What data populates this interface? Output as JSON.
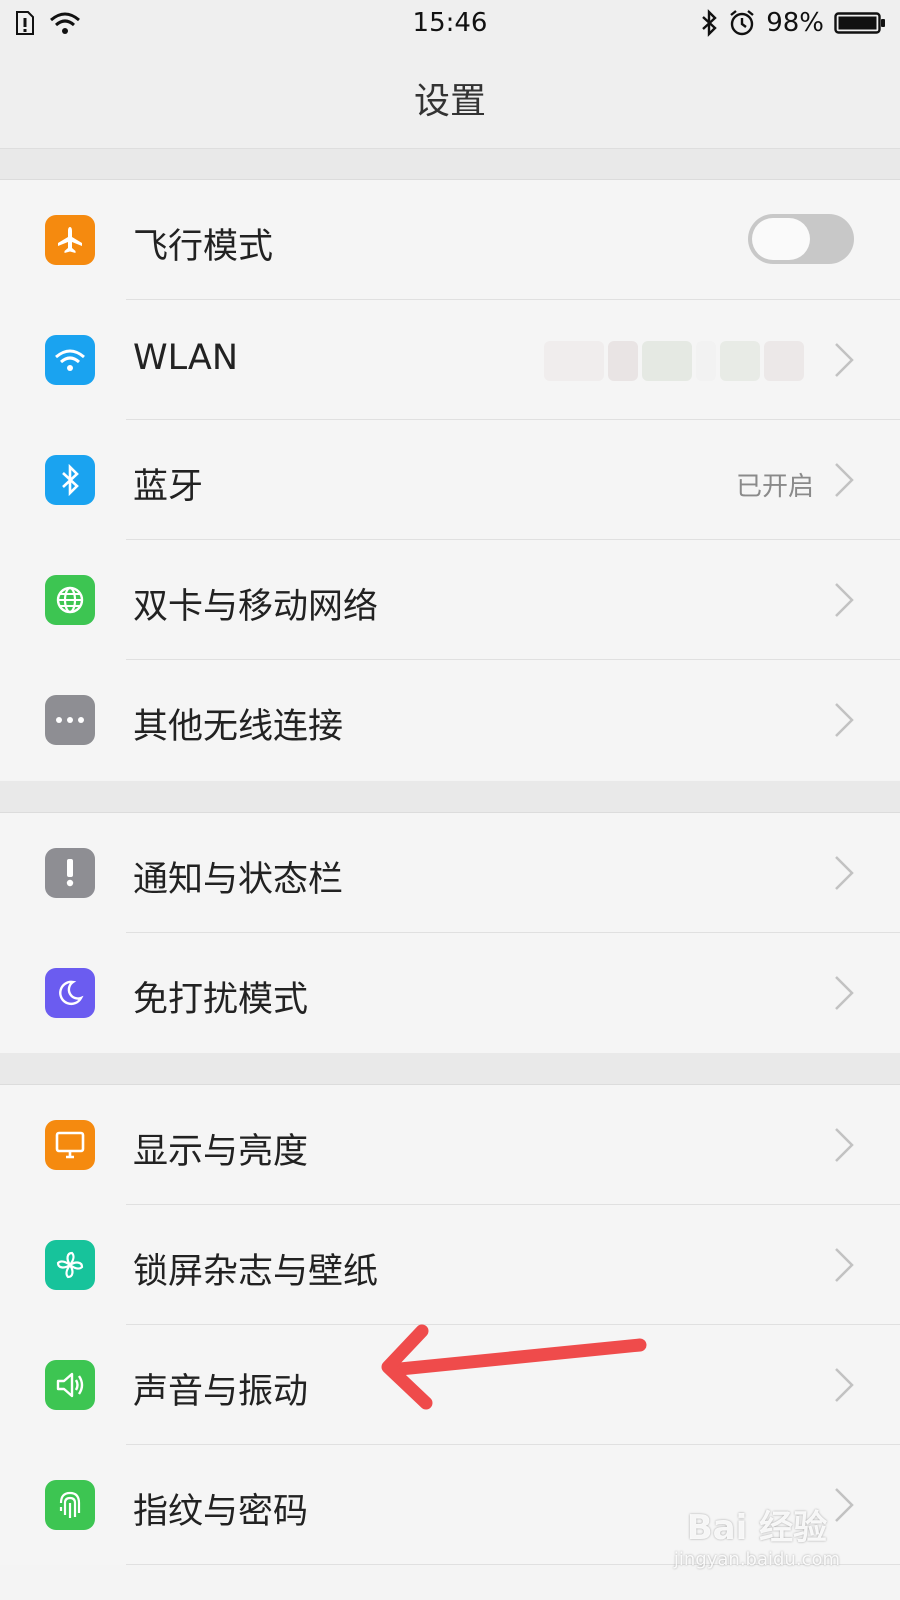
{
  "status_bar": {
    "time": "15:46",
    "battery": "98%"
  },
  "header": {
    "title": "设置"
  },
  "groups": [
    {
      "items": [
        {
          "label": "飞行模式",
          "icon": "airplane-icon",
          "icon_color": "#f58a0f",
          "control": "toggle",
          "toggle_on": false
        },
        {
          "label": "WLAN",
          "icon": "wifi-icon",
          "icon_color": "#1aa3f0",
          "control": "chevron",
          "value": ""
        },
        {
          "label": "蓝牙",
          "icon": "bluetooth-icon",
          "icon_color": "#1aa3f0",
          "control": "chevron",
          "value": "已开启"
        },
        {
          "label": "双卡与移动网络",
          "icon": "globe-icon",
          "icon_color": "#3dc552",
          "control": "chevron"
        },
        {
          "label": "其他无线连接",
          "icon": "more-icon",
          "icon_color": "#8e8e93",
          "control": "chevron"
        }
      ]
    },
    {
      "items": [
        {
          "label": "通知与状态栏",
          "icon": "notification-icon",
          "icon_color": "#8e8e93",
          "control": "chevron"
        },
        {
          "label": "免打扰模式",
          "icon": "moon-icon",
          "icon_color": "#6b5cf0",
          "control": "chevron"
        }
      ]
    },
    {
      "items": [
        {
          "label": "显示与亮度",
          "icon": "display-icon",
          "icon_color": "#f58a0f",
          "control": "chevron"
        },
        {
          "label": "锁屏杂志与壁纸",
          "icon": "pinwheel-icon",
          "icon_color": "#17c39b",
          "control": "chevron"
        },
        {
          "label": "声音与振动",
          "icon": "speaker-icon",
          "icon_color": "#3dc552",
          "control": "chevron"
        },
        {
          "label": "指纹与密码",
          "icon": "fingerprint-icon",
          "icon_color": "#3dc552",
          "control": "chevron"
        }
      ]
    }
  ],
  "annotation": {
    "arrow_color": "#ef4b4b"
  },
  "watermark": {
    "brand": "Bai 经验",
    "url": "jingyan.baidu.com"
  }
}
